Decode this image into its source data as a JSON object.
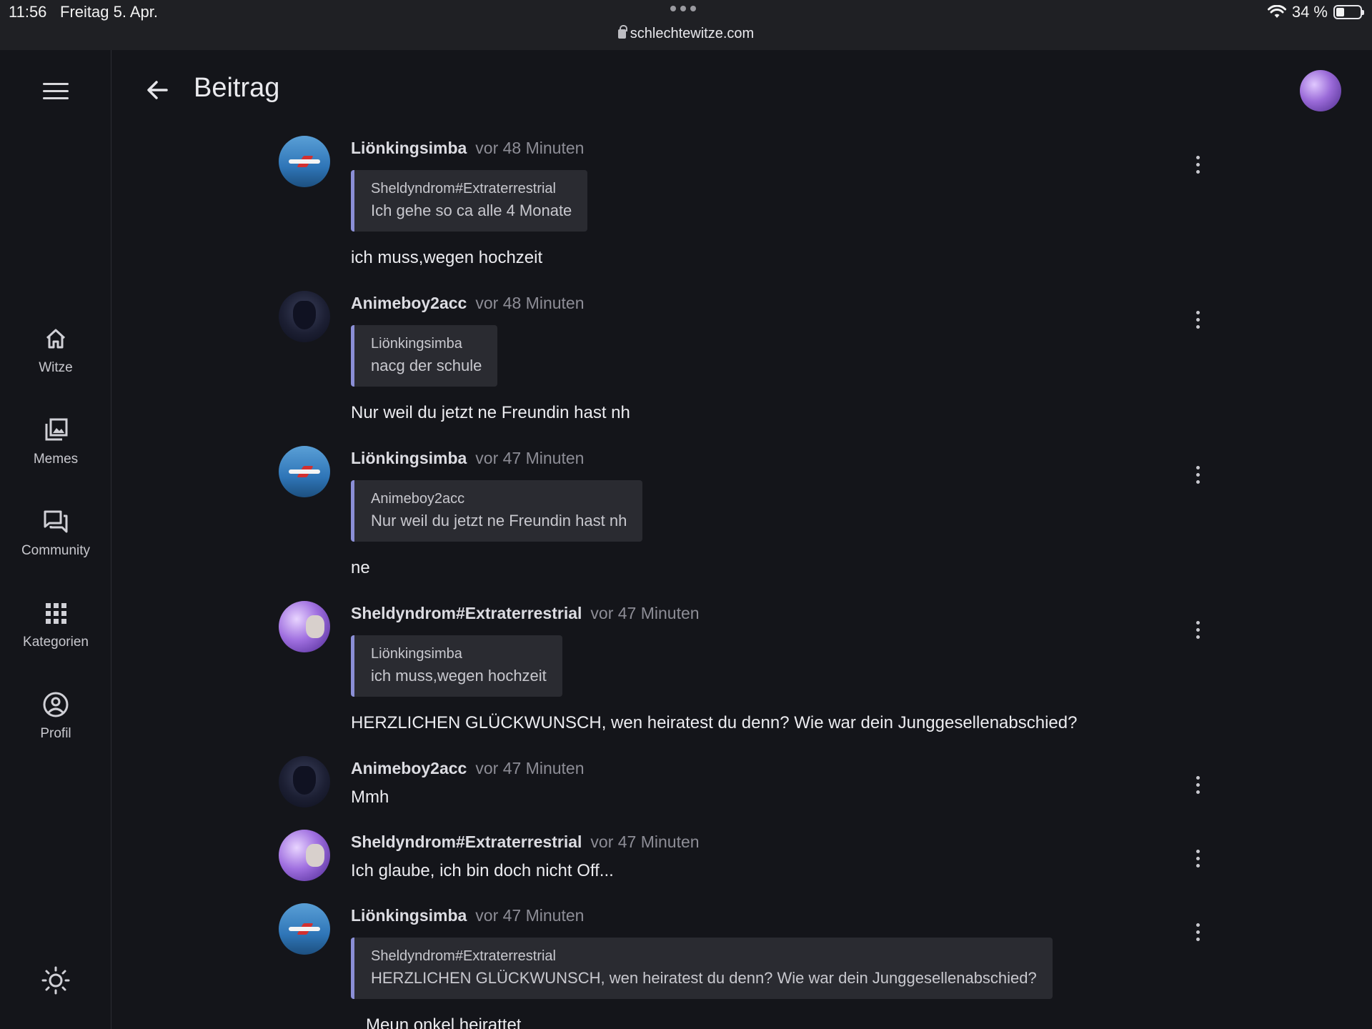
{
  "status_bar": {
    "time": "11:56",
    "date": "Freitag 5. Apr.",
    "url": "schlechtewitze.com",
    "battery_text": "34 %",
    "battery_level": 0.34
  },
  "sidebar": {
    "items": [
      {
        "label": "Witze",
        "icon": "home-icon"
      },
      {
        "label": "Memes",
        "icon": "image-gallery-icon"
      },
      {
        "label": "Community",
        "icon": "forum-icon"
      },
      {
        "label": "Kategorien",
        "icon": "grid-icon"
      },
      {
        "label": "Profil",
        "icon": "account-circle-icon"
      }
    ],
    "theme_icon": "sun-icon"
  },
  "header": {
    "title": "Beitrag"
  },
  "comments": [
    {
      "author": "Liönkingsimba",
      "time": "vor 48 Minuten",
      "avatar": "plane",
      "quote": {
        "author": "Sheldyndrom#Extraterrestrial",
        "text": "Ich gehe so ca alle 4 Monate"
      },
      "text": "ich muss,wegen hochzeit"
    },
    {
      "author": "Animeboy2acc",
      "time": "vor 48 Minuten",
      "avatar": "anime",
      "quote": {
        "author": "Liönkingsimba",
        "text": "nacg der schule"
      },
      "text": "Nur weil du jetzt ne Freundin hast nh"
    },
    {
      "author": "Liönkingsimba",
      "time": "vor 47 Minuten",
      "avatar": "plane",
      "quote": {
        "author": "Animeboy2acc",
        "text": "Nur weil du jetzt ne Freundin hast nh"
      },
      "text": "ne"
    },
    {
      "author": "Sheldyndrom#Extraterrestrial",
      "time": "vor 47 Minuten",
      "avatar": "purple",
      "quote": {
        "author": "Liönkingsimba",
        "text": "ich muss,wegen hochzeit"
      },
      "text": "HERZLICHEN GLÜCKWUNSCH, wen heiratest du denn? Wie war dein Junggesellenabschied?"
    },
    {
      "author": "Animeboy2acc",
      "time": "vor 47 Minuten",
      "avatar": "anime",
      "text": "Mmh"
    },
    {
      "author": "Sheldyndrom#Extraterrestrial",
      "time": "vor 47 Minuten",
      "avatar": "purple",
      "text": "Ich glaube, ich bin doch nicht Off..."
    },
    {
      "author": "Liönkingsimba",
      "time": "vor 47 Minuten",
      "avatar": "plane",
      "quote": {
        "author": "Sheldyndrom#Extraterrestrial",
        "text": "HERZLICHEN GLÜCKWUNSCH, wen heiratest du denn? Wie war dein Junggesellenabschied?"
      },
      "text": "Meun onkel heirattet"
    }
  ]
}
